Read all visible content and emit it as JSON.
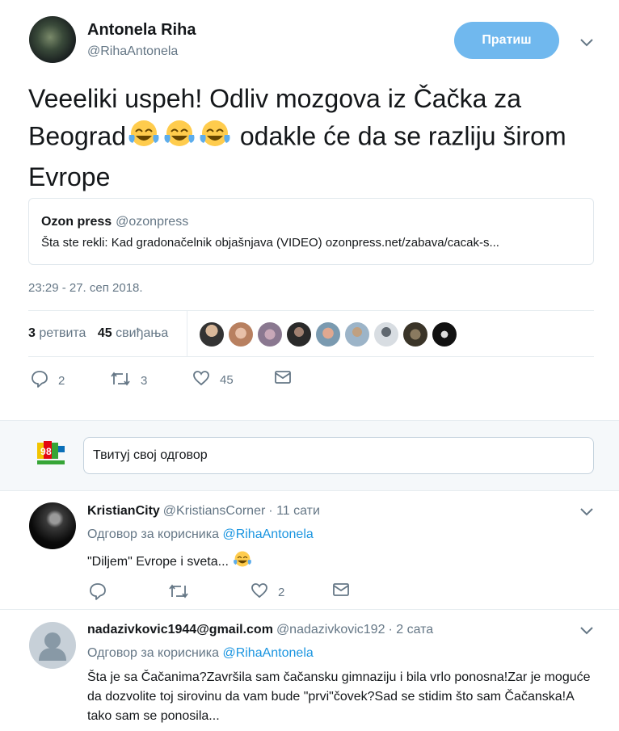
{
  "tweet": {
    "author_name": "Antonela Riha",
    "author_handle": "@RihaAntonela",
    "follow_label": "Пратиш",
    "text_part1": "Veeeliki uspeh! Odliv mozgova iz Čačka za Beograd",
    "text_part2": " odakle će da se razliju širom Evrope",
    "quote": {
      "name": "Ozon press",
      "handle": "@ozonpress",
      "text": "Šta ste rekli: Kad gradonačelnik objašnjava (VIDEO) ozonpress.net/zabava/cacak-s..."
    },
    "timestamp": "23:29 - 27. сеп 2018.",
    "stats": {
      "retweets_count": "3",
      "retweets_label": "ретвита",
      "likes_count": "45",
      "likes_label": "свиђања"
    },
    "actions": {
      "replies": "2",
      "retweets": "3",
      "likes": "45"
    }
  },
  "reply_box": {
    "placeholder": "Твитуј свој одговор"
  },
  "replies": [
    {
      "name": "KristianCity",
      "handle": "@KristiansCorner",
      "time": "· 11 сати",
      "reply_to_prefix": "Одговор за корисника",
      "reply_to_handle": "@RihaAntonela",
      "text": "\"Diljem\" Evrope i sveta...",
      "likes": "2"
    },
    {
      "name": "nadazivkovic1944@gmail.com",
      "handle": "@nadazivkovic192",
      "time": "· 2 сата",
      "reply_to_prefix": "Одговор за корисника",
      "reply_to_handle": "@RihaAntonela",
      "text": "Šta je sa Čačanima?Završila sam čačansku gimnaziju i bila vrlo ponosna!Zar je moguće da dozvolite toj sirovinu da vam bude \"prvi\"čovek?Sad se stidim što sam Čačanska!A tako sam se ponosila..."
    }
  ],
  "colors": {
    "accent": "#1b95e0",
    "follow_bg": "#70b8ee",
    "muted": "#657786",
    "like_heart": "#657786"
  }
}
